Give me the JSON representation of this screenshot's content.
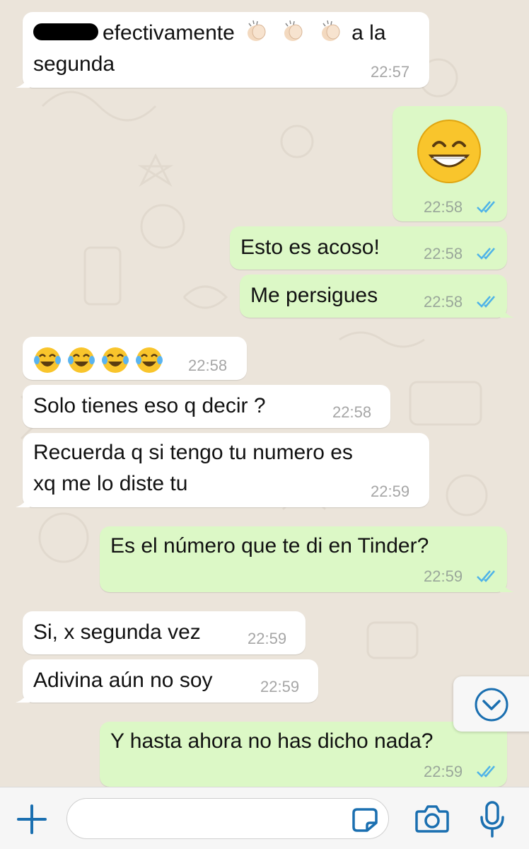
{
  "messages": [
    {
      "id": "m1",
      "direction": "in",
      "line1_text": "efectivamente",
      "line1_after": "a la",
      "line2": "segunda",
      "time": "22:57"
    },
    {
      "id": "m2",
      "direction": "out",
      "emoji": "grinning-face-with-smiling-eyes",
      "time": "22:58",
      "status": "read"
    },
    {
      "id": "m3",
      "direction": "out",
      "text": "Esto es acoso!",
      "time": "22:58",
      "status": "read"
    },
    {
      "id": "m4",
      "direction": "out",
      "text": "Me persigues",
      "time": "22:58",
      "status": "read"
    },
    {
      "id": "m5",
      "direction": "in",
      "emoji": "face-with-tears-of-joy x4",
      "time": "22:58"
    },
    {
      "id": "m6",
      "direction": "in",
      "text": "Solo tienes eso q decir ?",
      "time": "22:58"
    },
    {
      "id": "m7",
      "direction": "in",
      "line1": "Recuerda q si tengo tu numero es",
      "line2": "xq me lo diste tu",
      "time": "22:59"
    },
    {
      "id": "m8",
      "direction": "out",
      "text": "Es el número que te di en Tinder?",
      "time": "22:59",
      "status": "read"
    },
    {
      "id": "m9",
      "direction": "in",
      "text": "Si, x segunda vez",
      "time": "22:59"
    },
    {
      "id": "m10",
      "direction": "in",
      "text": "Adivina aún no soy",
      "time": "22:59"
    },
    {
      "id": "m11",
      "direction": "out",
      "text": "Y hasta ahora no has dicho nada?",
      "time": "22:59",
      "status": "read"
    }
  ],
  "composer": {
    "placeholder": "",
    "icons": [
      "plus-icon",
      "sticker-icon",
      "camera-icon",
      "microphone-icon"
    ]
  },
  "scroll_button": {
    "icon": "chevron-down-icon"
  },
  "colors": {
    "incoming_bubble": "#ffffff",
    "outgoing_bubble": "#dcf8c6",
    "read_ticks": "#4fb3e8",
    "accent_blue": "#1a6fb0",
    "wallpaper": "#ebe4da"
  }
}
